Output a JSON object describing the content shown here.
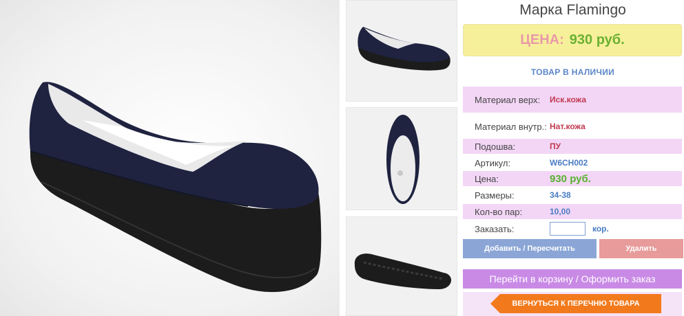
{
  "product": {
    "brand": "Марка Flamingo",
    "price_label": "ЦЕНА:",
    "price_value": "930 руб.",
    "availability": "ТОВАР В НАЛИЧИИ"
  },
  "specs": [
    {
      "label": "Материал верх:",
      "value": "Иск.кожа"
    },
    {
      "label": "Материал внутр.:",
      "value": "Нат.кожа"
    },
    {
      "label": "Подошва:",
      "value": "ПУ"
    },
    {
      "label": "Артикул:",
      "value": "W6CH002"
    },
    {
      "label": "Цена:",
      "value": "930 руб."
    },
    {
      "label": "Размеры:",
      "value": "34-38"
    },
    {
      "label": "Кол-во пар:",
      "value": "10,00"
    }
  ],
  "order": {
    "label": "Заказать:",
    "quantity_value": "",
    "unit": "кор."
  },
  "buttons": {
    "add": "Добавить / Пересчитать",
    "delete": "Удалить",
    "cart": "Перейти в корзину / Оформить заказ",
    "back": "ВЕРНУТЬСЯ К ПЕРЕЧНЮ ТОВАРА"
  },
  "colors": {
    "shoe": "#1f2340",
    "sole": "#1c1c1c",
    "accent_orange": "#f27a1c",
    "price_green": "#6ab132"
  }
}
